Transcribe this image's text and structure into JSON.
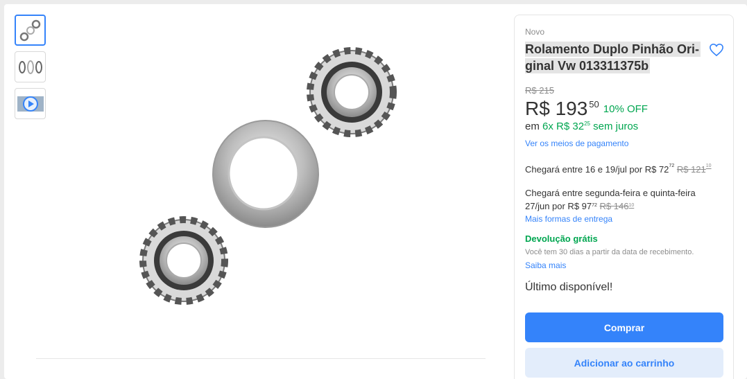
{
  "product": {
    "condition": "Novo",
    "title": "Rolamento Duplo Pinhão Original Vw 013311375b",
    "title_line1": "Rolamento Duplo Pinhão Ori-",
    "title_line2": "ginal Vw 013311375b"
  },
  "pricing": {
    "original_price": "R$ 215",
    "price_main": "R$ 193",
    "price_cents": "50",
    "discount": "10% OFF",
    "installments_prefix": "em",
    "installments_value": "6x R$ 32",
    "installments_cents": "25",
    "installments_suffix": "sem juros",
    "payment_link": "Ver os meios de pagamento"
  },
  "shipping": {
    "option1_text": "Chegará entre 16 e 19/jul por R$ 72",
    "option1_cents": "72",
    "option1_old": "R$ 121",
    "option1_old_cents": "10",
    "option2_text_a": "Chegará entre segunda-feira e quinta-feira",
    "option2_text_b": "27/jun por R$ 97",
    "option2_cents": "72",
    "option2_old": "R$ 146",
    "option2_old_cents": "10",
    "more_link": "Mais formas de entrega"
  },
  "returns": {
    "title": "Devolução grátis",
    "description": "Você tem 30 dias a partir da data de recebimento.",
    "link": "Saiba mais"
  },
  "stock": {
    "label": "Último disponível!"
  },
  "actions": {
    "buy_label": "Comprar",
    "cart_label": "Adicionar ao carrinho"
  },
  "colors": {
    "accent": "#3483fa",
    "green": "#00a650",
    "cart_bg": "#e3edfb"
  },
  "icons": {
    "favorite": "heart-icon",
    "video": "play-icon"
  }
}
